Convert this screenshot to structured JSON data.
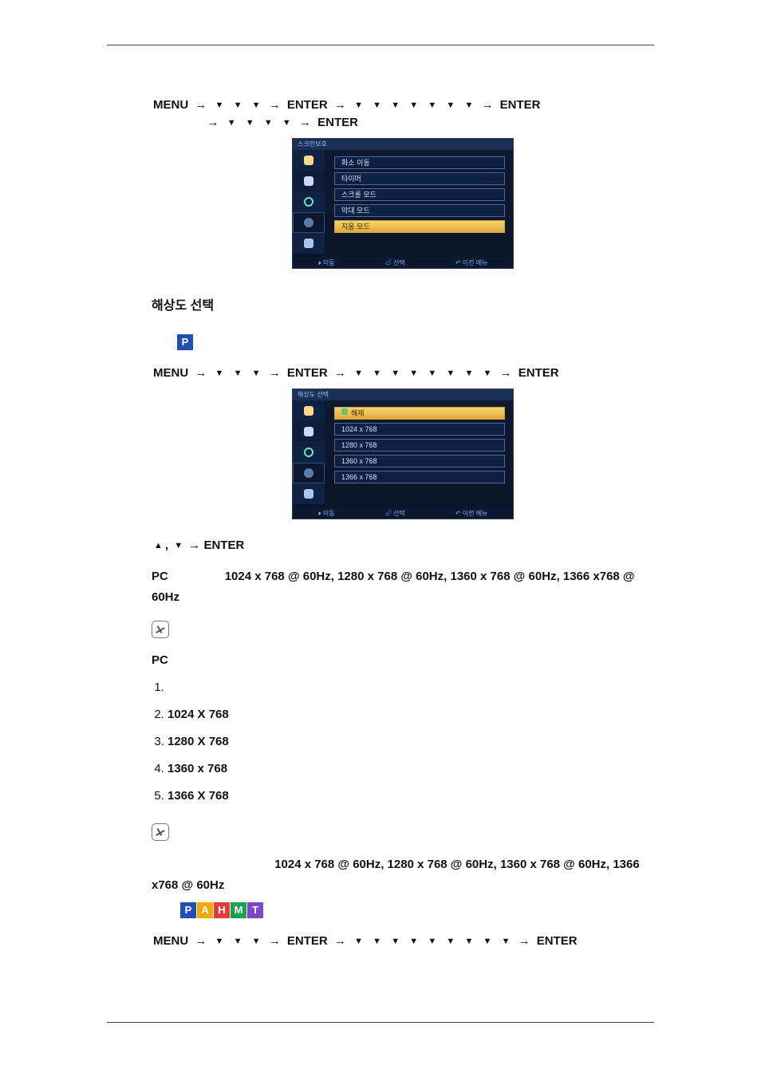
{
  "seq1": {
    "w1": "MENU",
    "w2": "ENTER",
    "w3": "ENTER",
    "w4": "ENTER",
    "arrows_a": [
      "▼",
      "▼",
      "▼"
    ],
    "arrows_b": [
      "▼",
      "▼",
      "▼",
      "▼",
      "▼",
      "▼",
      "▼"
    ],
    "arrows_c": [
      "▼",
      "▼",
      "▼",
      "▼"
    ]
  },
  "osd1": {
    "title": "스크린보호",
    "items": [
      "화소 이동",
      "타이머",
      "스크롤 모드",
      "막대 모드",
      "지움 모드"
    ],
    "hi_index": 4,
    "footer": {
      "a": "이동",
      "b": "선택",
      "c": "이전 메뉴"
    }
  },
  "section2_title": "해상도 선택",
  "seq2": {
    "w1": "MENU",
    "w2": "ENTER",
    "w3": "ENTER",
    "arrows_a": [
      "▼",
      "▼",
      "▼"
    ],
    "arrows_b": [
      "▼",
      "▼",
      "▼",
      "▼",
      "▼",
      "▼",
      "▼",
      "▼"
    ]
  },
  "osd2": {
    "title": "해상도 선택",
    "items": [
      "해제",
      "1024 x 768",
      "1280 x 768",
      "1360 x 768",
      "1366 x 768"
    ],
    "hi_index": 0,
    "footer": {
      "a": "이동",
      "b": "선택",
      "c": "이전 메뉴"
    }
  },
  "ud_line": {
    "a": "▲",
    "d": "▼",
    "w": "ENTER"
  },
  "para_pc1_a": "PC",
  "para_pc1_b": "1024 x 768 @ 60Hz, 1280 x 768 @ 60Hz, 1360 x 768 @ 60Hz, 1366 x768 @ 60Hz",
  "subhead_pc": "PC",
  "reslist": [
    {
      "t": ""
    },
    {
      "t": "1024 X 768"
    },
    {
      "t": "1280 X 768"
    },
    {
      "t": "1360 x 768"
    },
    {
      "t": "1366 X 768"
    }
  ],
  "para_res_modes": "1024 x 768 @ 60Hz, 1280 x 768 @ 60Hz, 1360 x 768 @ 60Hz, 1366 x768 @ 60Hz",
  "mode_badges": [
    "P",
    "A",
    "H",
    "M",
    "T"
  ],
  "seq3": {
    "w1": "MENU",
    "w2": "ENTER",
    "w3": "ENTER",
    "arrows_a": [
      "▼",
      "▼",
      "▼"
    ],
    "arrows_b": [
      "▼",
      "▼",
      "▼",
      "▼",
      "▼",
      "▼",
      "▼",
      "▼",
      "▼"
    ]
  }
}
